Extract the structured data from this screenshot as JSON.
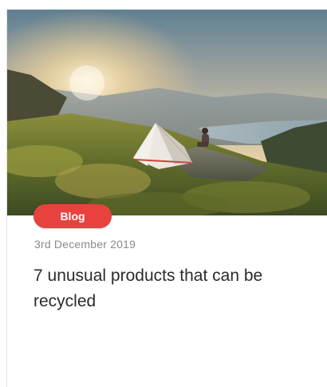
{
  "card": {
    "category_label": "Blog",
    "date": "3rd December 2019",
    "title": "7 unusual products that can be recycled"
  },
  "colors": {
    "badge_bg": "#e8423f",
    "badge_text": "#ffffff",
    "date_text": "#8a8a8a",
    "title_text": "#2b2b2b"
  },
  "hero_image": {
    "subject": "tent-on-mountain-sunset-photo"
  }
}
